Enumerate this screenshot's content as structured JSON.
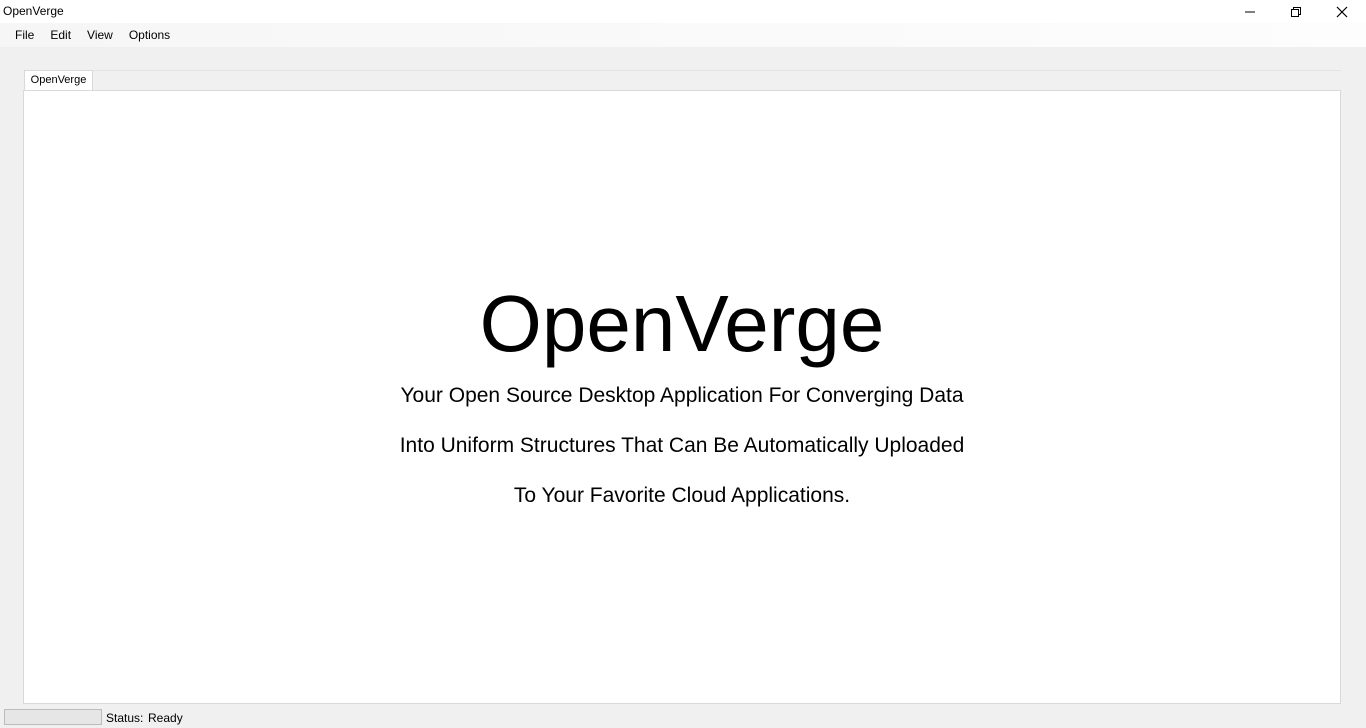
{
  "window": {
    "title": "OpenVerge",
    "controls": [
      "minimize-icon",
      "restore-icon",
      "close-icon"
    ]
  },
  "menu": {
    "items": [
      {
        "label": "File"
      },
      {
        "label": "Edit"
      },
      {
        "label": "View"
      },
      {
        "label": "Options"
      }
    ]
  },
  "tabs": [
    {
      "label": "OpenVerge",
      "active": true
    }
  ],
  "hero": {
    "title": "OpenVerge",
    "lines": [
      "Your Open Source Desktop Application For Converging Data",
      "Into Uniform Structures That Can Be Automatically Uploaded",
      "To Your Favorite Cloud Applications."
    ]
  },
  "status": {
    "label": "Status:",
    "value": "Ready",
    "progress": 0
  },
  "colors": {
    "window_bg": "#f0f0f0",
    "content_bg": "#ffffff",
    "border": "#d9d9d9"
  }
}
